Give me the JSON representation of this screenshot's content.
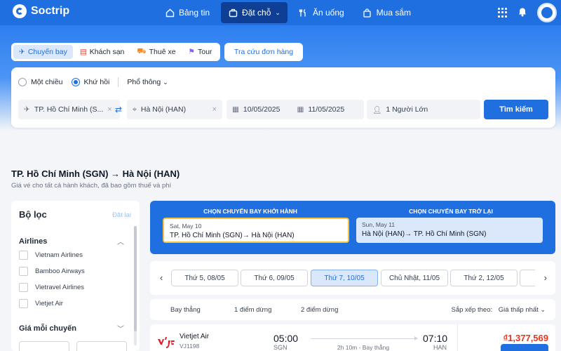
{
  "brand": {
    "name": "Soctrip"
  },
  "nav": {
    "items": [
      {
        "label": "Bảng tin",
        "icon": "home-icon"
      },
      {
        "label": "Đặt chỗ",
        "icon": "suitcase-icon",
        "active": true
      },
      {
        "label": "Ăn uống",
        "icon": "dining-icon"
      },
      {
        "label": "Mua sắm",
        "icon": "shopping-bag-icon"
      }
    ]
  },
  "service_tabs": [
    {
      "label": "Chuyến bay",
      "active": true
    },
    {
      "label": "Khách sạn"
    },
    {
      "label": "Thuê xe"
    },
    {
      "label": "Tour"
    }
  ],
  "lookup_label": "Tra cứu đơn hàng",
  "trip_type": {
    "one_way": "Một chiều",
    "round_trip": "Khứ hồi",
    "selected": "round_trip",
    "cabin": "Phổ thông"
  },
  "search": {
    "origin": "TP. Hồ Chí Minh (S...",
    "destination": "Hà Nội (HAN)",
    "depart_date": "10/05/2025",
    "return_date": "11/05/2025",
    "passengers": "1  Người Lớn",
    "button": "Tìm kiếm"
  },
  "route": {
    "title": "TP. Hồ Chí Minh (SGN) → Hà Nội (HAN)",
    "subtitle": "Giá vé cho tất cả hành khách, đã bao gồm thuế và phí"
  },
  "filters": {
    "title": "Bộ lọc",
    "reset": "Đặt lại",
    "airlines_title": "Airlines",
    "airlines": [
      "Vietnam Airlines",
      "Bamboo Airways",
      "Vietravel Airlines",
      "Vietjet Air"
    ],
    "price_title": "Giá mỗi chuyến"
  },
  "legs": {
    "outbound_label": "CHỌN CHUYẾN BAY KHỞI HÀNH",
    "return_label": "CHỌN CHUYẾN BAY TRỞ LẠI",
    "outbound": {
      "date": "Sat, May 10",
      "route": "TP. Hồ Chí Minh (SGN)→ Hà Nội (HAN)"
    },
    "return": {
      "date": "Sun, May 11",
      "route": "Hà Nội (HAN)→ TP. Hồ Chí Minh (SGN)"
    }
  },
  "dates": [
    {
      "label": "Thứ 5, 08/05"
    },
    {
      "label": "Thứ 6, 09/05"
    },
    {
      "label": "Thứ 7, 10/05",
      "active": true
    },
    {
      "label": "Chủ Nhật, 11/05"
    },
    {
      "label": "Thứ 2, 12/05"
    }
  ],
  "stops": {
    "direct": "Bay thẳng",
    "one": "1 điểm dừng",
    "two": "2 điểm dừng"
  },
  "sort": {
    "label": "Sắp xếp theo:",
    "value": "Giá thấp nhất"
  },
  "flight": {
    "logo": "Vietjet Air",
    "airline": "Vietjet Air",
    "code": "VJ1198",
    "depart_time": "05:00",
    "depart_airport": "SGN",
    "arrive_time": "07:10",
    "arrive_airport": "HAN",
    "duration": "2h 10m - Bay thẳng",
    "price": "₫1,377,569"
  },
  "colors": {
    "primary": "#1f6fe0",
    "price": "#e5361f",
    "highlight": "#f6c343"
  }
}
